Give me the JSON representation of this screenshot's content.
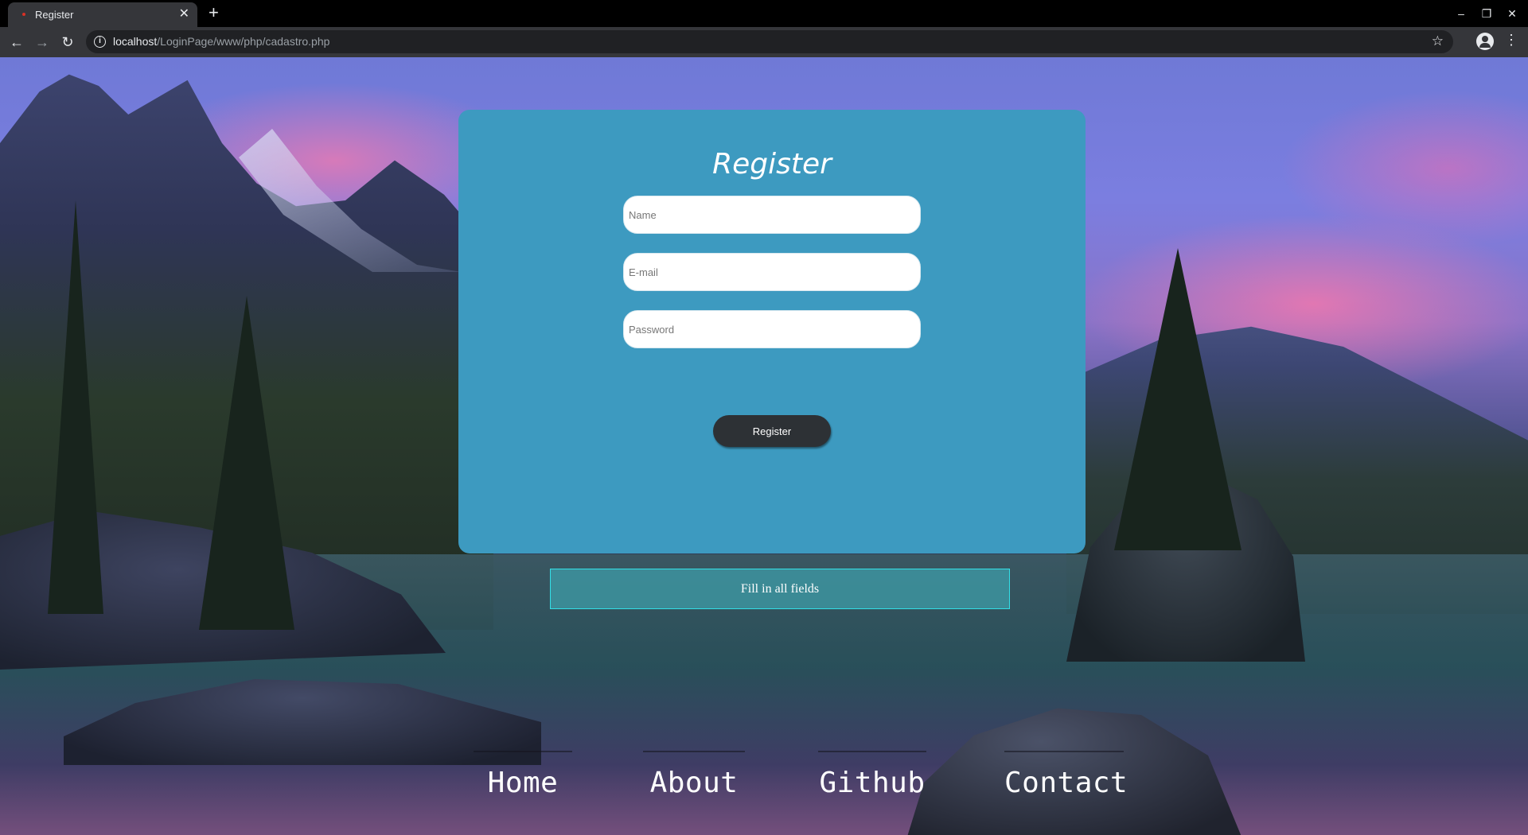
{
  "browser": {
    "tab_title": "Register",
    "new_tab_symbol": "+",
    "url_host": "localhost",
    "url_path": "/LoginPage/www/php/cadastro.php",
    "favicon_color": "#d93025"
  },
  "card": {
    "title": "Register",
    "background_color": "#3d9ac0",
    "fields": {
      "name_placeholder": "Name",
      "email_placeholder": "E-mail",
      "password_placeholder": "Password"
    },
    "register_label": "Register"
  },
  "alert": {
    "message": "Fill in all fields",
    "border_color": "#32e0e8"
  },
  "footer_nav": {
    "home": "Home",
    "about": "About",
    "github": "Github",
    "contact": "Contact"
  }
}
